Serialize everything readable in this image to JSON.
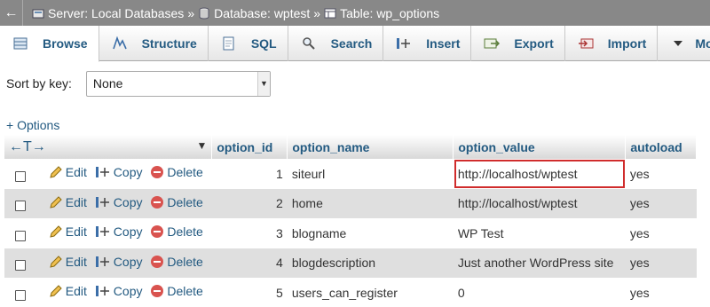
{
  "breadcrumb": {
    "back": "←",
    "server_label": "Server: Local Databases",
    "database_label": "Database: wptest",
    "table_label": "Table: wp_options",
    "separator": "»"
  },
  "tabs": [
    {
      "label": "Browse",
      "icon": "browse-icon",
      "active": true
    },
    {
      "label": "Structure",
      "icon": "structure-icon"
    },
    {
      "label": "SQL",
      "icon": "sql-icon"
    },
    {
      "label": "Search",
      "icon": "search-icon"
    },
    {
      "label": "Insert",
      "icon": "insert-icon"
    },
    {
      "label": "Export",
      "icon": "export-icon"
    },
    {
      "label": "Import",
      "icon": "import-icon"
    },
    {
      "label": "More",
      "icon": "chevron-down-icon"
    }
  ],
  "sort": {
    "label": "Sort by key:",
    "selected": "None"
  },
  "options_link": "+ Options",
  "table": {
    "header_arrows": "←T→",
    "columns": [
      "option_id",
      "option_name",
      "option_value",
      "autoload"
    ],
    "actions": {
      "edit": "Edit",
      "copy": "Copy",
      "delete": "Delete"
    },
    "rows": [
      {
        "option_id": "1",
        "option_name": "siteurl",
        "option_value": "http://localhost/wptest",
        "autoload": "yes"
      },
      {
        "option_id": "2",
        "option_name": "home",
        "option_value": "http://localhost/wptest",
        "autoload": "yes"
      },
      {
        "option_id": "3",
        "option_name": "blogname",
        "option_value": "WP Test",
        "autoload": "yes"
      },
      {
        "option_id": "4",
        "option_name": "blogdescription",
        "option_value": "Just another WordPress site",
        "autoload": "yes"
      },
      {
        "option_id": "5",
        "option_name": "users_can_register",
        "option_value": "0",
        "autoload": "yes"
      }
    ]
  },
  "colors": {
    "link": "#235a81",
    "highlight": "#d02c2c",
    "topbar": "#888888"
  }
}
